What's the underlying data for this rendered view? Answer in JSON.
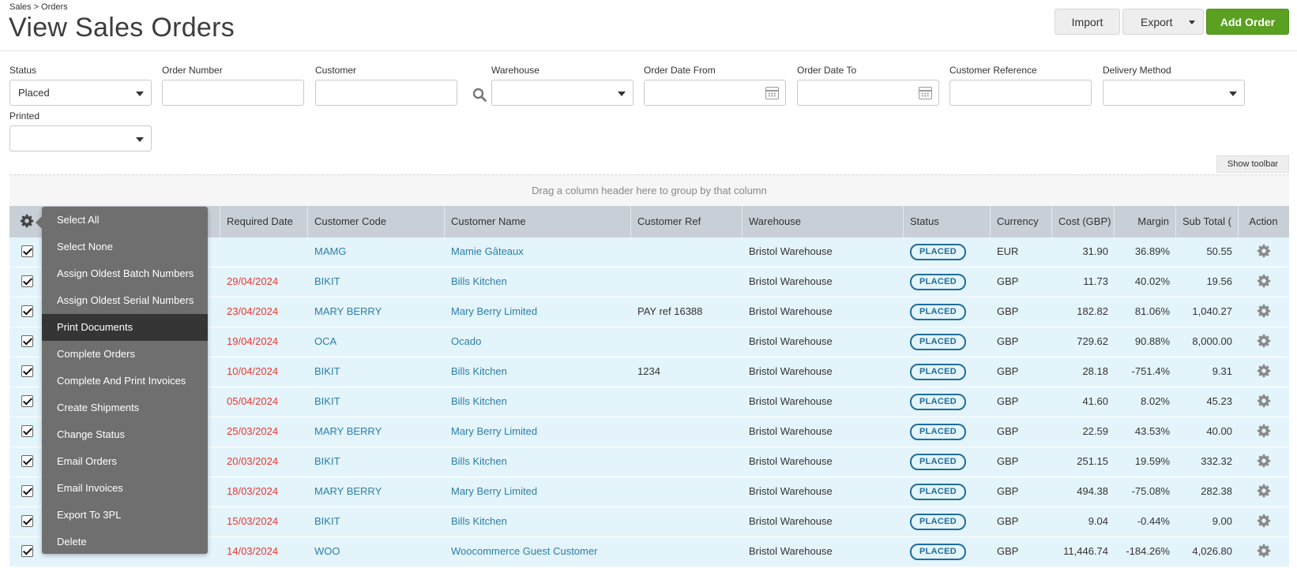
{
  "breadcrumb": "Sales > Orders",
  "page_title": "View Sales Orders",
  "toolbar": {
    "import_label": "Import",
    "export_label": "Export",
    "add_label": "Add Order"
  },
  "filters": {
    "status": {
      "label": "Status",
      "value": "Placed"
    },
    "order_number": {
      "label": "Order Number",
      "value": ""
    },
    "customer": {
      "label": "Customer",
      "value": ""
    },
    "warehouse": {
      "label": "Warehouse",
      "value": ""
    },
    "order_date_from": {
      "label": "Order Date From",
      "value": ""
    },
    "order_date_to": {
      "label": "Order Date To",
      "value": ""
    },
    "customer_reference": {
      "label": "Customer Reference",
      "value": ""
    },
    "delivery_method": {
      "label": "Delivery Method",
      "value": ""
    },
    "printed": {
      "label": "Printed",
      "value": ""
    }
  },
  "show_toolbar_label": "Show toolbar",
  "group_bar_text": "Drag a column header here to group by that column",
  "columns": {
    "required_date": "Required Date",
    "customer_code": "Customer Code",
    "customer_name": "Customer Name",
    "customer_ref": "Customer Ref",
    "warehouse": "Warehouse",
    "status": "Status",
    "currency": "Currency",
    "cost": "Cost (GBP)",
    "margin": "Margin",
    "sub_total": "Sub Total (",
    "action": "Action"
  },
  "menu": [
    "Select All",
    "Select None",
    "Assign Oldest Batch Numbers",
    "Assign Oldest Serial Numbers",
    "Print Documents",
    "Complete Orders",
    "Complete And Print Invoices",
    "Create Shipments",
    "Change Status",
    "Email Orders",
    "Email Invoices",
    "Export To 3PL",
    "Delete"
  ],
  "rows": [
    {
      "required_date": "",
      "customer_code": "MAMG",
      "customer_name": "Mamie Gâteaux",
      "customer_ref": "",
      "warehouse": "Bristol Warehouse",
      "status": "PLACED",
      "currency": "EUR",
      "cost": "31.90",
      "margin": "36.89%",
      "sub_total": "50.55"
    },
    {
      "required_date": "29/04/2024",
      "customer_code": "BIKIT",
      "customer_name": "Bills Kitchen",
      "customer_ref": "",
      "warehouse": "Bristol Warehouse",
      "status": "PLACED",
      "currency": "GBP",
      "cost": "11.73",
      "margin": "40.02%",
      "sub_total": "19.56"
    },
    {
      "required_date": "23/04/2024",
      "customer_code": "MARY BERRY",
      "customer_name": "Mary Berry Limited",
      "customer_ref": "PAY ref 16388",
      "warehouse": "Bristol Warehouse",
      "status": "PLACED",
      "currency": "GBP",
      "cost": "182.82",
      "margin": "81.06%",
      "sub_total": "1,040.27"
    },
    {
      "required_date": "19/04/2024",
      "customer_code": "OCA",
      "customer_name": "Ocado",
      "customer_ref": "",
      "warehouse": "Bristol Warehouse",
      "status": "PLACED",
      "currency": "GBP",
      "cost": "729.62",
      "margin": "90.88%",
      "sub_total": "8,000.00"
    },
    {
      "required_date": "10/04/2024",
      "customer_code": "BIKIT",
      "customer_name": "Bills Kitchen",
      "customer_ref": "1234",
      "warehouse": "Bristol Warehouse",
      "status": "PLACED",
      "currency": "GBP",
      "cost": "28.18",
      "margin": "-751.4%",
      "sub_total": "9.31"
    },
    {
      "required_date": "05/04/2024",
      "customer_code": "BIKIT",
      "customer_name": "Bills Kitchen",
      "customer_ref": "",
      "warehouse": "Bristol Warehouse",
      "status": "PLACED",
      "currency": "GBP",
      "cost": "41.60",
      "margin": "8.02%",
      "sub_total": "45.23"
    },
    {
      "required_date": "25/03/2024",
      "customer_code": "MARY BERRY",
      "customer_name": "Mary Berry Limited",
      "customer_ref": "",
      "warehouse": "Bristol Warehouse",
      "status": "PLACED",
      "currency": "GBP",
      "cost": "22.59",
      "margin": "43.53%",
      "sub_total": "40.00"
    },
    {
      "required_date": "20/03/2024",
      "customer_code": "BIKIT",
      "customer_name": "Bills Kitchen",
      "customer_ref": "",
      "warehouse": "Bristol Warehouse",
      "status": "PLACED",
      "currency": "GBP",
      "cost": "251.15",
      "margin": "19.59%",
      "sub_total": "332.32"
    },
    {
      "required_date": "18/03/2024",
      "customer_code": "MARY BERRY",
      "customer_name": "Mary Berry Limited",
      "customer_ref": "",
      "warehouse": "Bristol Warehouse",
      "status": "PLACED",
      "currency": "GBP",
      "cost": "494.38",
      "margin": "-75.08%",
      "sub_total": "282.38"
    },
    {
      "required_date": "15/03/2024",
      "customer_code": "BIKIT",
      "customer_name": "Bills Kitchen",
      "customer_ref": "",
      "warehouse": "Bristol Warehouse",
      "status": "PLACED",
      "currency": "GBP",
      "cost": "9.04",
      "margin": "-0.44%",
      "sub_total": "9.00"
    },
    {
      "required_date": "14/03/2024",
      "customer_code": "WOO",
      "customer_name": "Woocommerce Guest Customer",
      "customer_ref": "",
      "warehouse": "Bristol Warehouse",
      "status": "PLACED",
      "currency": "GBP",
      "cost": "11,446.74",
      "margin": "-184.26%",
      "sub_total": "4,026.80"
    }
  ],
  "colors": {
    "accent_green": "#5aa021",
    "link_blue": "#2b7fa7",
    "date_red": "#e53935",
    "row_bg": "#e4f4fb",
    "header_bg": "#c8cfd6",
    "menu_bg": "#6f6f6f",
    "menu_active_bg": "#353535"
  }
}
